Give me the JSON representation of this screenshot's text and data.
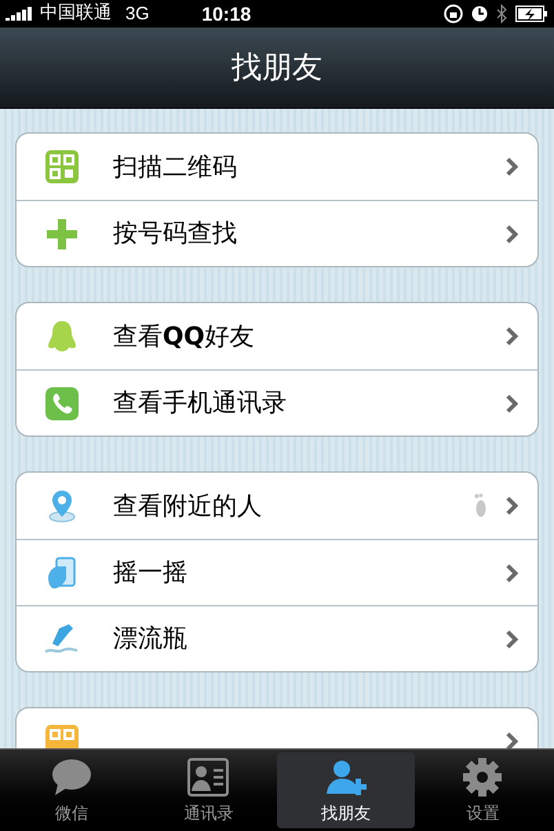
{
  "status_bar": {
    "carrier": "中国联通",
    "network": "3G",
    "time": "10:18"
  },
  "nav_bar": {
    "title": "找朋友"
  },
  "groups": [
    {
      "items": [
        {
          "label": "扫描二维码",
          "footprint": false
        },
        {
          "label": "按号码查找",
          "footprint": false
        }
      ]
    },
    {
      "items": [
        {
          "label": "查看**QQ**好友",
          "footprint": false
        },
        {
          "label": "查看手机通讯录",
          "footprint": false
        }
      ]
    },
    {
      "items": [
        {
          "label": "查看附近的人",
          "footprint": true
        },
        {
          "label": "摇一摇",
          "footprint": false
        },
        {
          "label": "漂流瓶",
          "footprint": false
        }
      ]
    },
    {
      "items": [
        {
          "footprint": false
        }
      ]
    }
  ],
  "tab_bar": [
    {
      "label": "微信",
      "selected": false
    },
    {
      "label": "通讯录",
      "selected": false
    },
    {
      "label": "找朋友",
      "selected": true
    },
    {
      "label": "设置",
      "selected": false
    }
  ]
}
